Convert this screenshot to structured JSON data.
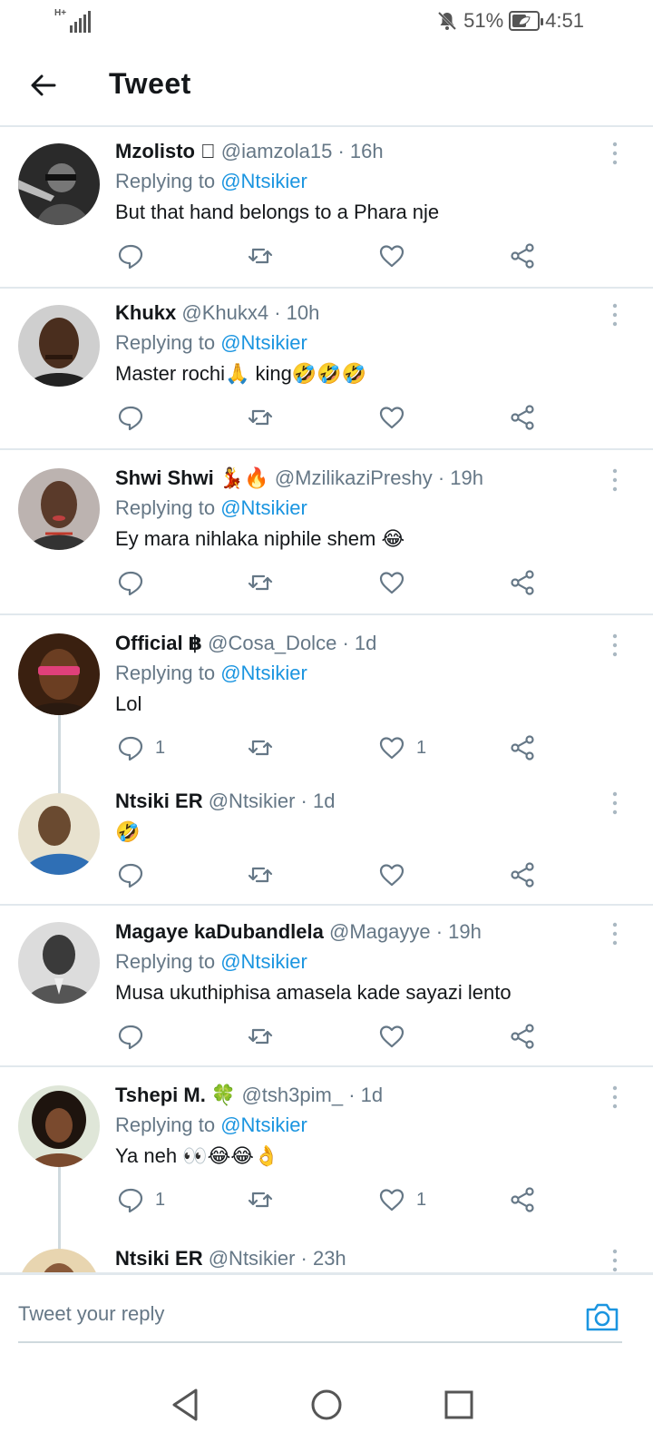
{
  "status_bar": {
    "network": "H+",
    "battery_percent": "51%",
    "battery_level": 0.51,
    "time": "4:51",
    "icons": [
      "signal-icon",
      "mute-bell-icon",
      "battery-saver-icon"
    ]
  },
  "header": {
    "title": "Tweet",
    "back_icon": "arrow-left-icon"
  },
  "tweets": [
    {
      "name": "Mzolisto ",
      "handle": "@iamzola15",
      "time": "· 16h",
      "replying_prefix": "Replying to",
      "replying_to": "@Ntsikier",
      "text": "But that hand belongs to a Phara nje",
      "reply_count": "",
      "like_count": ""
    },
    {
      "name": "Khukx",
      "handle": "@Khukx4",
      "time": "· 10h",
      "replying_prefix": "Replying to",
      "replying_to": "@Ntsikier",
      "text": "Master rochi🙏 king🤣🤣🤣",
      "reply_count": "",
      "like_count": ""
    },
    {
      "name": "Shwi Shwi 💃🔥",
      "handle": "@MzilikaziPreshy",
      "time": "· 19h",
      "replying_prefix": "Replying to",
      "replying_to": "@Ntsikier",
      "text": "Ey mara nihlaka niphile shem 😂",
      "reply_count": "",
      "like_count": ""
    },
    {
      "name": "Official ฿",
      "handle": "@Cosa_Dolce",
      "time": "· 1d",
      "replying_prefix": "Replying to",
      "replying_to": "@Ntsikier",
      "text": "Lol",
      "reply_count": "1",
      "like_count": "1"
    },
    {
      "name": "Ntsiki ER",
      "handle": "@Ntsikier",
      "time": "· 1d",
      "text": "🤣",
      "reply_count": "",
      "like_count": ""
    },
    {
      "name": "Magaye kaDubandlela",
      "handle": "@Magayye",
      "time": "· 19h",
      "replying_prefix": "Replying to",
      "replying_to": "@Ntsikier",
      "text": "Musa ukuthiphisa amasela kade sayazi lento",
      "reply_count": "",
      "like_count": ""
    },
    {
      "name": "Tshepi M. 🍀",
      "handle": "@tsh3pim_",
      "time": "· 1d",
      "replying_prefix": "Replying to",
      "replying_to": "@Ntsikier",
      "text": "Ya neh 👀😂😂👌",
      "reply_count": "1",
      "like_count": "1"
    },
    {
      "name": "Ntsiki ER",
      "handle": "@Ntsikier",
      "time": "· 23h"
    }
  ],
  "reply_bar": {
    "placeholder": "Tweet your reply",
    "camera_icon": "camera-icon"
  },
  "nav_bar": {
    "icons": [
      "nav-back-icon",
      "nav-home-icon",
      "nav-recent-apps-icon"
    ]
  }
}
